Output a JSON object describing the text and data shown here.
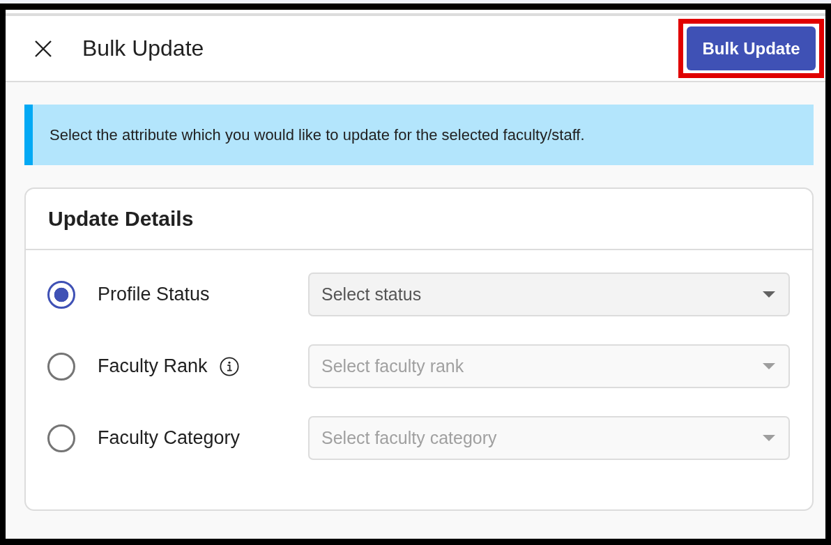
{
  "header": {
    "title": "Bulk Update",
    "action_button": {
      "label": "Bulk Update",
      "highlighted": true
    }
  },
  "banner": {
    "text": "Select the attribute which you would like to update for the selected faculty/staff."
  },
  "card": {
    "title": "Update Details",
    "attributes": [
      {
        "label": "Profile Status",
        "selected": true,
        "info": false,
        "dropdown": {
          "placeholder": "Select status",
          "disabled": false
        }
      },
      {
        "label": "Faculty Rank",
        "selected": false,
        "info": true,
        "dropdown": {
          "placeholder": "Select faculty rank",
          "disabled": true
        }
      },
      {
        "label": "Faculty Category",
        "selected": false,
        "info": false,
        "dropdown": {
          "placeholder": "Select faculty category",
          "disabled": true
        }
      }
    ]
  }
}
